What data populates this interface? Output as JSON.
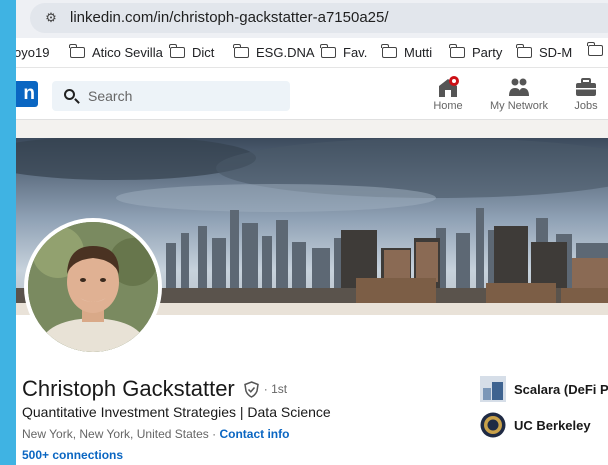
{
  "browser": {
    "url": "linkedin.com/in/christoph-gackstatter-a7150a25/",
    "bookmarks": [
      "oyo19",
      "Atico Sevilla",
      "Dict",
      "ESG.DNA",
      "Fav.",
      "Mutti",
      "Party",
      "SD-M"
    ]
  },
  "header": {
    "search_placeholder": "Search",
    "nav": [
      {
        "label": "Home",
        "icon": "home-icon"
      },
      {
        "label": "My Network",
        "icon": "network-icon"
      },
      {
        "label": "Jobs",
        "icon": "jobs-icon"
      }
    ],
    "brand_color": "#0a66c2"
  },
  "profile": {
    "name": "Christoph Gackstatter",
    "degree": "· 1st",
    "headline": "Quantitative Investment Strategies | Data Science",
    "location": "New York, New York, United States ·",
    "contact_label": "Contact info",
    "connections": "500+ connections",
    "experience": [
      {
        "name": "Scalara (DeFi Pul",
        "icon": "company-logo"
      },
      {
        "name": "UC Berkeley",
        "icon": "university-seal"
      }
    ]
  }
}
